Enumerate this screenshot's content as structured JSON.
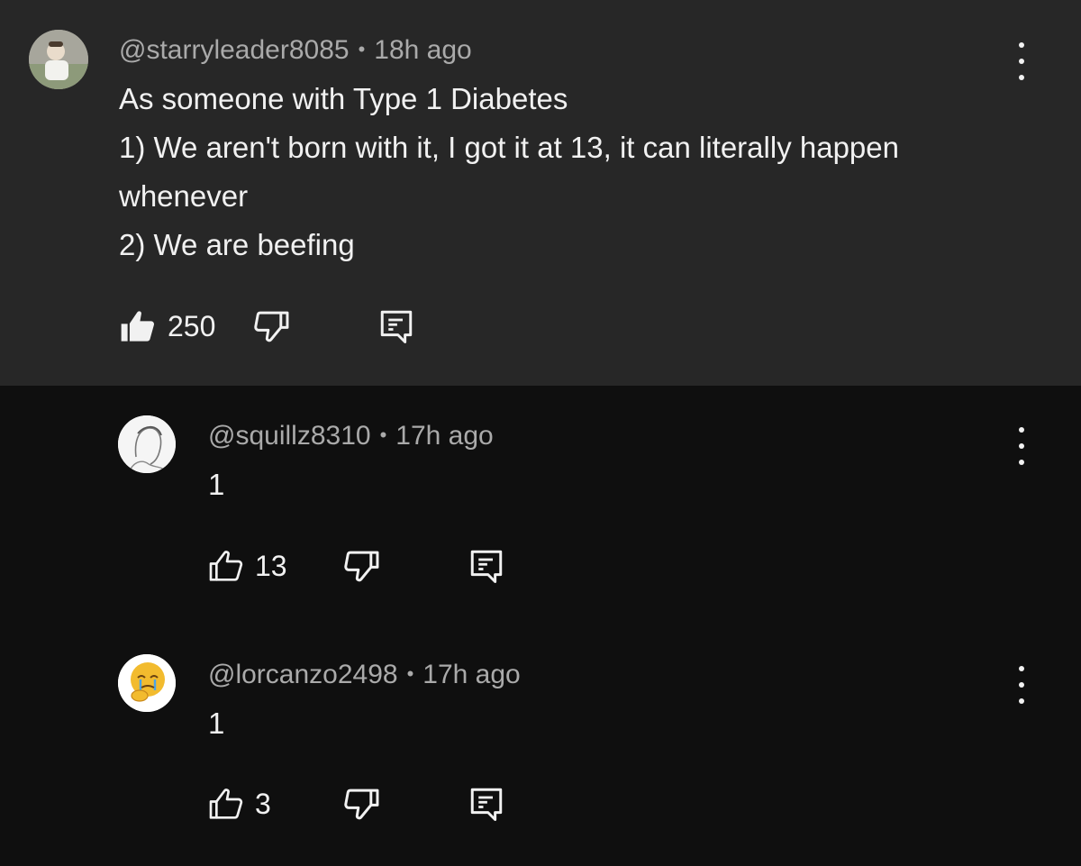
{
  "comments": [
    {
      "handle": "@starryleader8085",
      "age": "18h ago",
      "text": "As someone with Type 1 Diabetes\n1) We aren't born with it, I got it at 13, it can literally happen whenever\n2) We are beefing",
      "likes": "250",
      "liked": true
    },
    {
      "handle": "@squillz8310",
      "age": "17h ago",
      "text": "1",
      "likes": "13",
      "liked": false
    },
    {
      "handle": "@lorcanzo2498",
      "age": "17h ago",
      "text": "1",
      "likes": "3",
      "liked": false
    }
  ],
  "icons": {
    "like": "thumbs-up-icon",
    "dislike": "thumbs-down-icon",
    "reply": "reply-comment-icon",
    "more": "more-vertical-icon"
  },
  "colors": {
    "highlighted_comment_bg": "#272727",
    "page_bg": "#0f0f0f",
    "primary_text": "#f1f1f1",
    "secondary_text": "#aaaaaa"
  }
}
